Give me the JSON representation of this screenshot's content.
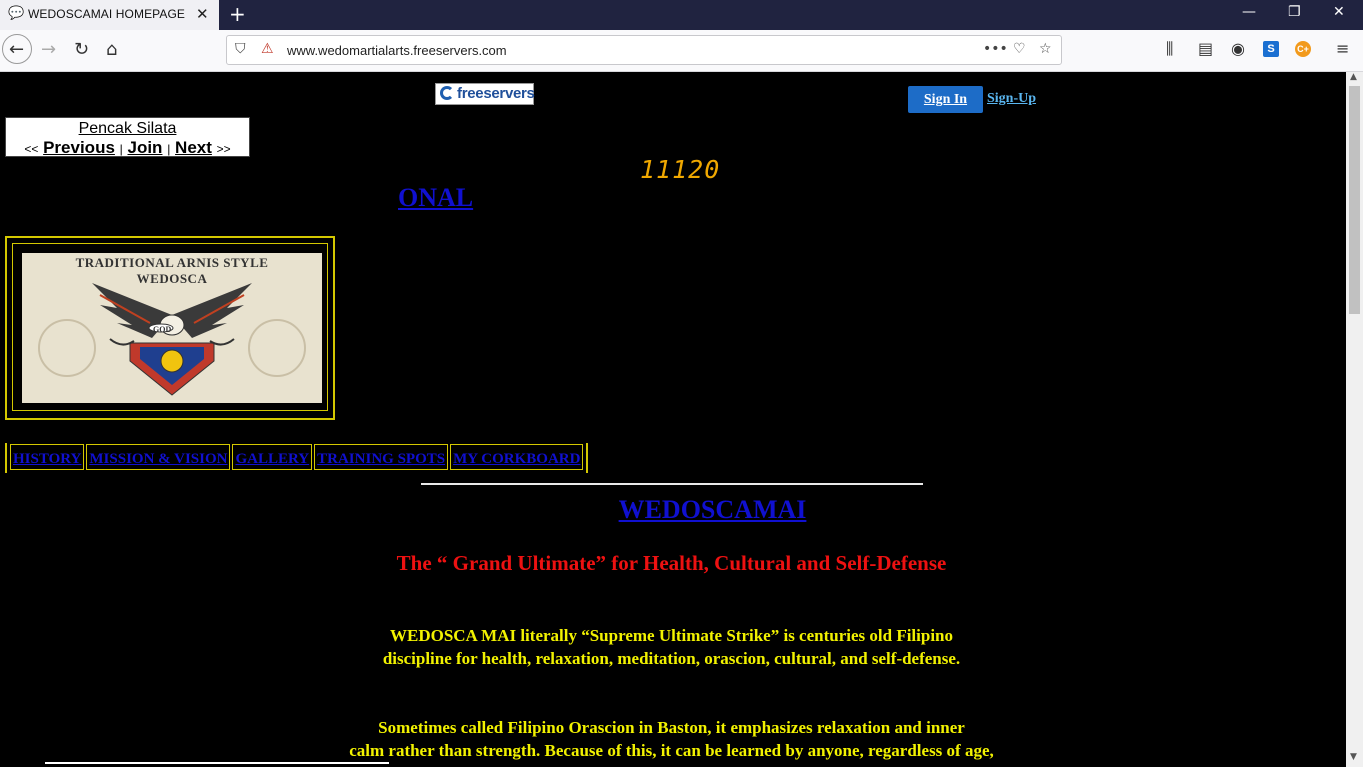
{
  "browser": {
    "tab_title": "WEDOSCAMAI HOMEPAGE",
    "url": "www.wedomartialarts.freeservers.com"
  },
  "page": {
    "freeservers_logo": "freeservers",
    "sign_in": "Sign In",
    "sign_up": "Sign-Up",
    "webring": {
      "title": "Pencak Silata",
      "prev_prefix": "<<",
      "previous": "Previous",
      "sep1": "|",
      "join": "Join",
      "sep2": "|",
      "next": "Next",
      "next_suffix": ">>"
    },
    "counter": "11120",
    "marquee_fragment": "ONAL",
    "emblem": {
      "line1": "TRADITIONAL ARNIS STYLE",
      "line2": "WEDOSCA",
      "seal_text": "GOD"
    },
    "menu": [
      "HISTORY",
      "MISSION & VISION",
      "GALLERY",
      "TRAINING SPOTS",
      "MY CORKBOARD"
    ],
    "heading": "WEDOSCAMAI",
    "subheading": "The “ Grand Ultimate” for Health, Cultural and Self-Defense",
    "para1_line1": "WEDOSCA MAI literally “Supreme Ultimate Strike” is centuries old Filipino",
    "para1_line2": "discipline for health, relaxation, meditation, orascion, cultural, and self-defense.",
    "para2_line1": "Sometimes called Filipino Orascion in Baston, it emphasizes relaxation and inner",
    "para2_line2": "calm rather than strength. Because of this, it can be learned by anyone, regardless of age,"
  },
  "colors": {
    "background": "#000000",
    "link_blue": "#1010d0",
    "subhead_red": "#ee1111",
    "body_yellow": "#f2f200",
    "frame_gold": "#d4c800",
    "counter_amber": "#f0a800"
  }
}
